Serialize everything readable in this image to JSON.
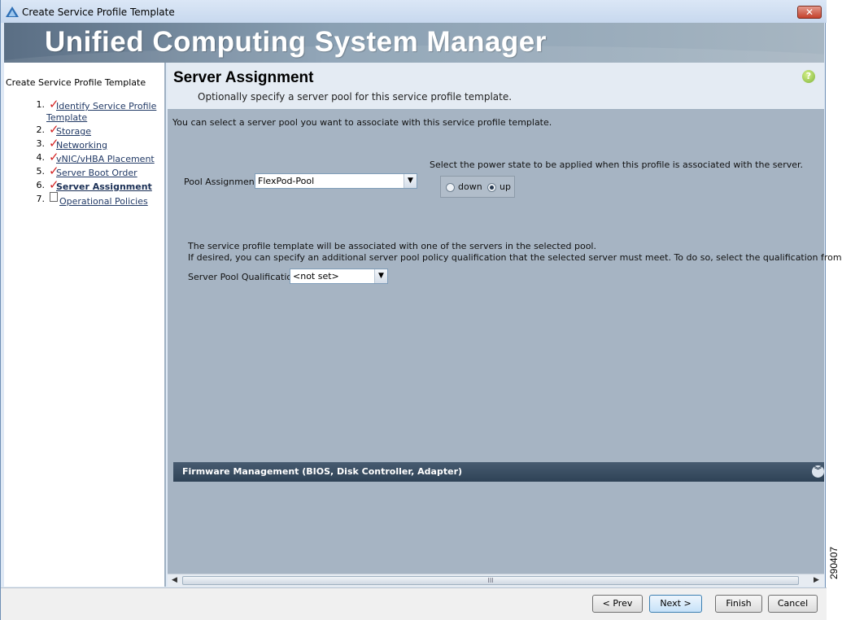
{
  "window": {
    "title": "Create Service Profile Template",
    "close_label": "✕"
  },
  "banner": {
    "title": "Unified Computing System Manager"
  },
  "sidebar": {
    "title": "Create Service Profile Template",
    "steps": [
      {
        "num": "1.",
        "label_line1": "Identify Service Profile",
        "label_line2": "Template",
        "state": "done"
      },
      {
        "num": "2.",
        "label": "Storage",
        "state": "done"
      },
      {
        "num": "3.",
        "label": "Networking",
        "state": "done"
      },
      {
        "num": "4.",
        "label": "vNIC/vHBA Placement",
        "state": "done"
      },
      {
        "num": "5.",
        "label": "Server Boot Order",
        "state": "done"
      },
      {
        "num": "6.",
        "label": "Server Assignment",
        "state": "current"
      },
      {
        "num": "7.",
        "label": "Operational Policies",
        "state": "pending"
      }
    ]
  },
  "header": {
    "title": "Server Assignment",
    "subtitle": "Optionally specify a server pool for this service profile template.",
    "help_icon": "?"
  },
  "content": {
    "intro": "You can select a server pool you want to associate with this service profile template.",
    "pool_label": "Pool Assignment:",
    "pool_value": "FlexPod-Pool",
    "power_text": "Select the power state to be applied when this profile is associated with the server.",
    "power_options": {
      "down": "down",
      "up": "up",
      "selected": "up"
    },
    "assoc_line1": "The service profile template will be associated with one of the servers in the selected pool.",
    "assoc_line2": "If desired, you can specify an additional server pool policy qualification that the selected server must meet. To do so, select the qualification from the list.",
    "qual_label": "Server Pool Qualification:",
    "qual_value": "<not set>",
    "accordion_title": "Firmware Management (BIOS, Disk Controller, Adapter)",
    "scroll_grip": "III"
  },
  "footer": {
    "prev": "< Prev",
    "next": "Next >",
    "finish": "Finish",
    "cancel": "Cancel"
  },
  "figure_id": "290407",
  "colors": {
    "check": "#d32323",
    "banner": "#7c91a6",
    "content_bg": "#a6b4c3",
    "accordion": "#3b4e62"
  }
}
